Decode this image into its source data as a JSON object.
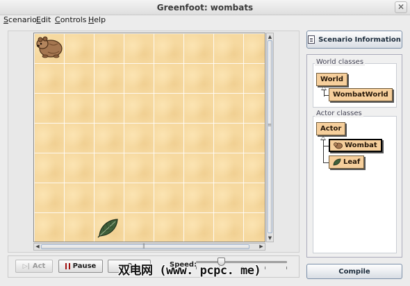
{
  "window": {
    "title": "Greenfoot: wombats",
    "close_glyph": "✕"
  },
  "menu": {
    "items": [
      "Scenario",
      "Edit",
      "Controls",
      "Help"
    ]
  },
  "world": {
    "background_color": "#f6d9a0",
    "grid_columns": 8,
    "grid_rows": 7,
    "actors": [
      {
        "type": "Wombat",
        "icon": "wombat-icon",
        "cell": [
          0,
          0
        ]
      },
      {
        "type": "Leaf",
        "icon": "leaf-icon",
        "cell": [
          2,
          6
        ]
      }
    ]
  },
  "sidebar": {
    "info_button": "Scenario Information",
    "world_classes_title": "World classes",
    "world_classes": [
      "World",
      "WombatWorld"
    ],
    "actor_classes_title": "Actor classes",
    "actor_classes": [
      "Actor",
      "Wombat",
      "Leaf"
    ],
    "selected_class": "Wombat",
    "compile_button": "Compile"
  },
  "controls": {
    "act_label": "Act",
    "act_enabled": false,
    "pause_label": "Pause",
    "reset_label": "Reset",
    "speed_label": "Speed:",
    "speed_value": 0.28
  },
  "watermark": "双电网 (www. pcpc. me)",
  "colors": {
    "class_box": "#f6cf9c",
    "world_tile": "#f6d9a0",
    "pause_icon": "#a01010"
  }
}
